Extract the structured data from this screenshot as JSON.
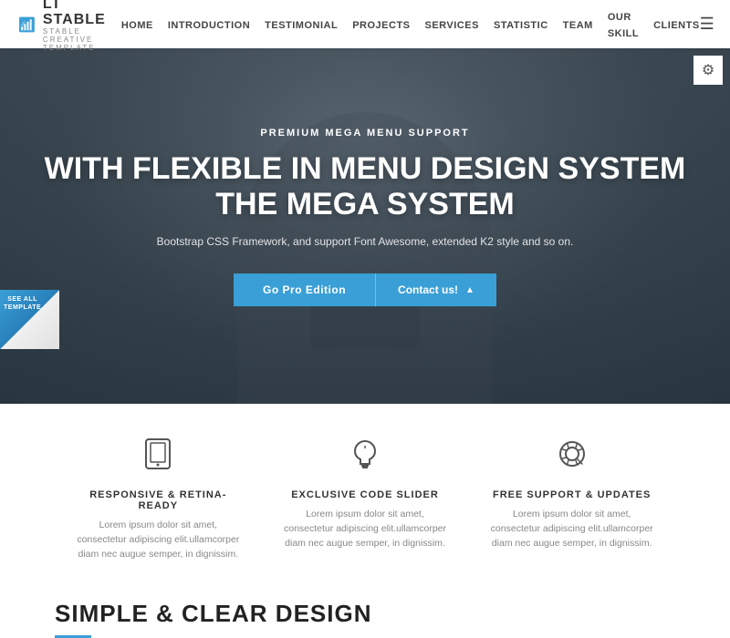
{
  "logo": {
    "main": "LT STABLE",
    "sub": "STABLE CREATIVE TEMPLATE"
  },
  "nav": {
    "links": [
      {
        "label": "HOME",
        "active": true
      },
      {
        "label": "INTRODUCTION",
        "active": false
      },
      {
        "label": "TESTIMONIAL",
        "active": false
      },
      {
        "label": "PROJECTS",
        "active": false
      },
      {
        "label": "SERVICES",
        "active": false
      },
      {
        "label": "STATISTIC",
        "active": false
      },
      {
        "label": "TEAM",
        "active": false
      },
      {
        "label": "OUR SKILL",
        "active": false
      },
      {
        "label": "CLIENTS",
        "active": false
      }
    ]
  },
  "hero": {
    "subtitle": "PREMIUM MEGA MENU SUPPORT",
    "title_line1": "WITH FLEXIBLE IN MENU DESIGN SYSTEM",
    "title_line2": "THE MEGA SYSTEM",
    "description": "Bootstrap CSS Framework, and support Font Awesome, extended K2 style and so on.",
    "btn_gopro": "Go Pro Edition",
    "btn_contact": "Contact us!"
  },
  "badge": {
    "line1": "SEE ALL",
    "line2": "TEMPLATE"
  },
  "features": [
    {
      "icon": "tablet",
      "title": "RESPONSIVE & RETINA-READY",
      "desc": "Lorem ipsum dolor sit amet, consectetur adipiscing elit.ullamcorper diam nec augue semper, in dignissim."
    },
    {
      "icon": "bulb",
      "title": "EXCLUSIVE CODE SLIDER",
      "desc": "Lorem ipsum dolor sit amet, consectetur adipiscing elit.ullamcorper diam nec augue semper, in dignissim."
    },
    {
      "icon": "lifebuoy",
      "title": "FREE SUPPORT & UPDATES",
      "desc": "Lorem ipsum dolor sit amet, consectetur adipiscing elit.ullamcorper diam nec augue semper, in dignissim."
    }
  ],
  "bottom": {
    "title": "SIMPLE & CLEAR DESIGN"
  },
  "colors": {
    "accent": "#3a9fd6"
  }
}
